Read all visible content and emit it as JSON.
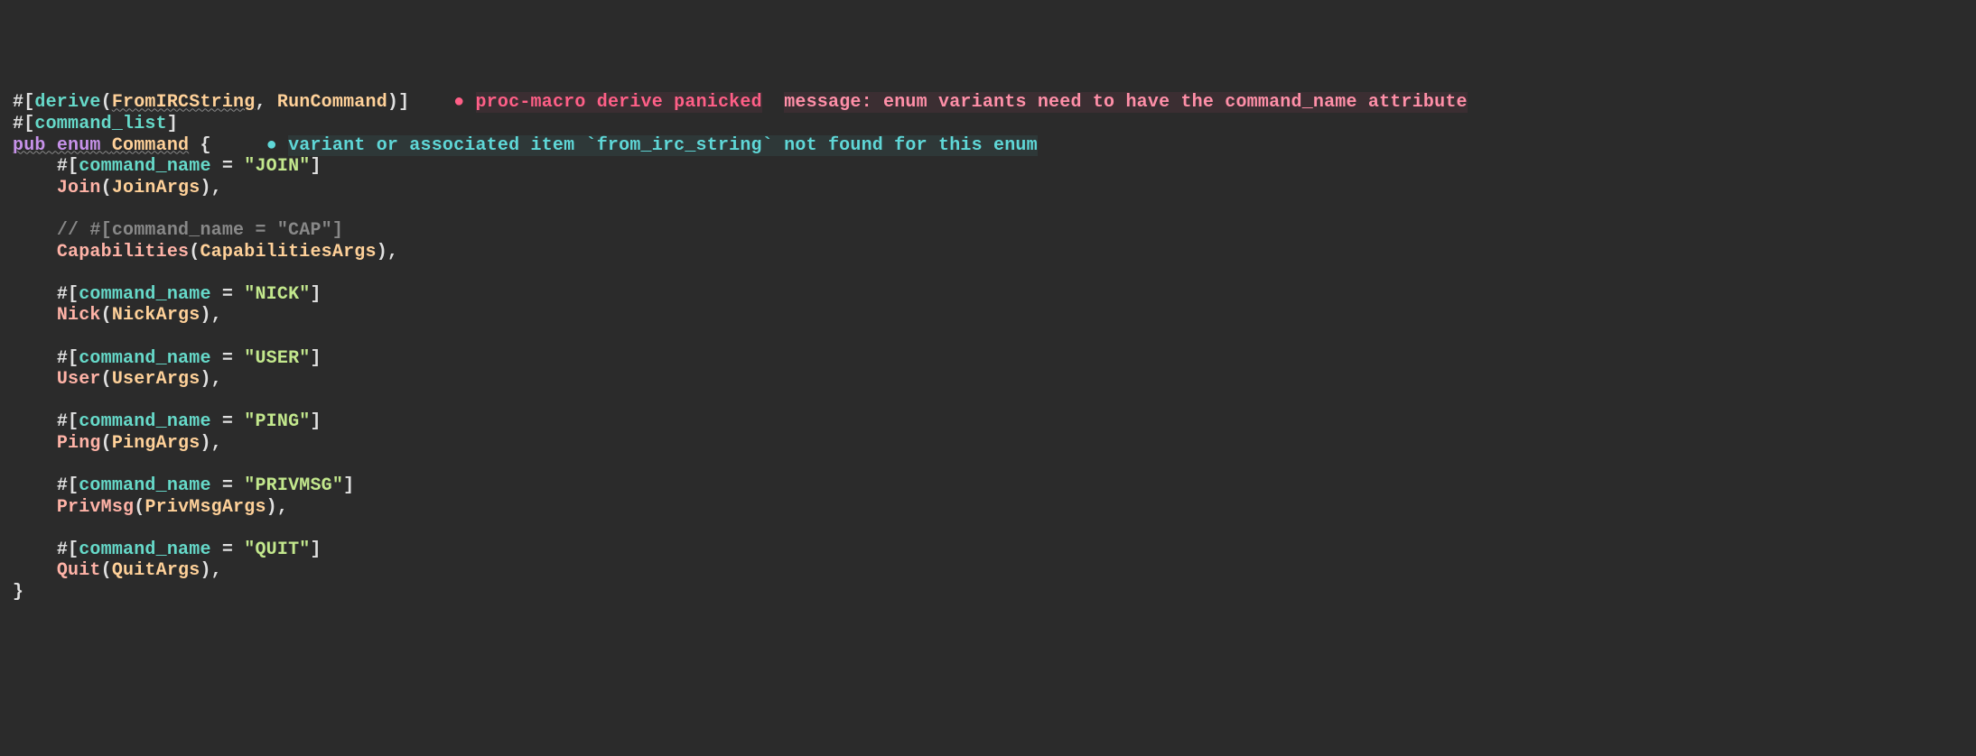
{
  "lines": {
    "l1_derive_hash": "#",
    "l1_derive_open": "[",
    "l1_derive_word": "derive",
    "l1_paren_open": "(",
    "l1_macro1": "FromIRCString",
    "l1_comma": ", ",
    "l1_macro2": "RunCommand",
    "l1_paren_close": ")",
    "l1_derive_close": "]",
    "l1_spacer": "    ",
    "l1_bullet": "● ",
    "l1_diag1": "proc-macro derive panicked",
    "l1_diag_spacer": "  ",
    "l1_diag2": "message: enum variants need to have the command_name attribute",
    "l2_hash": "#",
    "l2_open": "[",
    "l2_attr": "command_list",
    "l2_close": "]",
    "l3_pub": "pub ",
    "l3_enum": "enum ",
    "l3_name": "Command",
    "l3_space": " ",
    "l3_brace": "{",
    "l3_spacer": "     ",
    "l3_bullet": "● ",
    "l3_diag": "variant or associated item `from_irc_string` not found for this enum",
    "indent": "    ",
    "attr_hash": "#",
    "attr_open": "[",
    "attr_name": "command_name",
    "attr_eq": " = ",
    "attr_close": "]",
    "join_str": "\"JOIN\"",
    "join_variant": "Join",
    "join_type": "JoinArgs",
    "cap_comment": "// #[command_name = \"CAP\"]",
    "cap_variant": "Capabilities",
    "cap_type": "CapabilitiesArgs",
    "nick_str": "\"NICK\"",
    "nick_variant": "Nick",
    "nick_type": "NickArgs",
    "user_str": "\"USER\"",
    "user_variant": "User",
    "user_type": "UserArgs",
    "ping_str": "\"PING\"",
    "ping_variant": "Ping",
    "ping_type": "PingArgs",
    "privmsg_str": "\"PRIVMSG\"",
    "privmsg_variant": "PrivMsg",
    "privmsg_type": "PrivMsgArgs",
    "quit_str": "\"QUIT\"",
    "quit_variant": "Quit",
    "quit_type": "QuitArgs",
    "paren_open": "(",
    "paren_close": ")",
    "comma": ",",
    "close_brace": "}"
  }
}
